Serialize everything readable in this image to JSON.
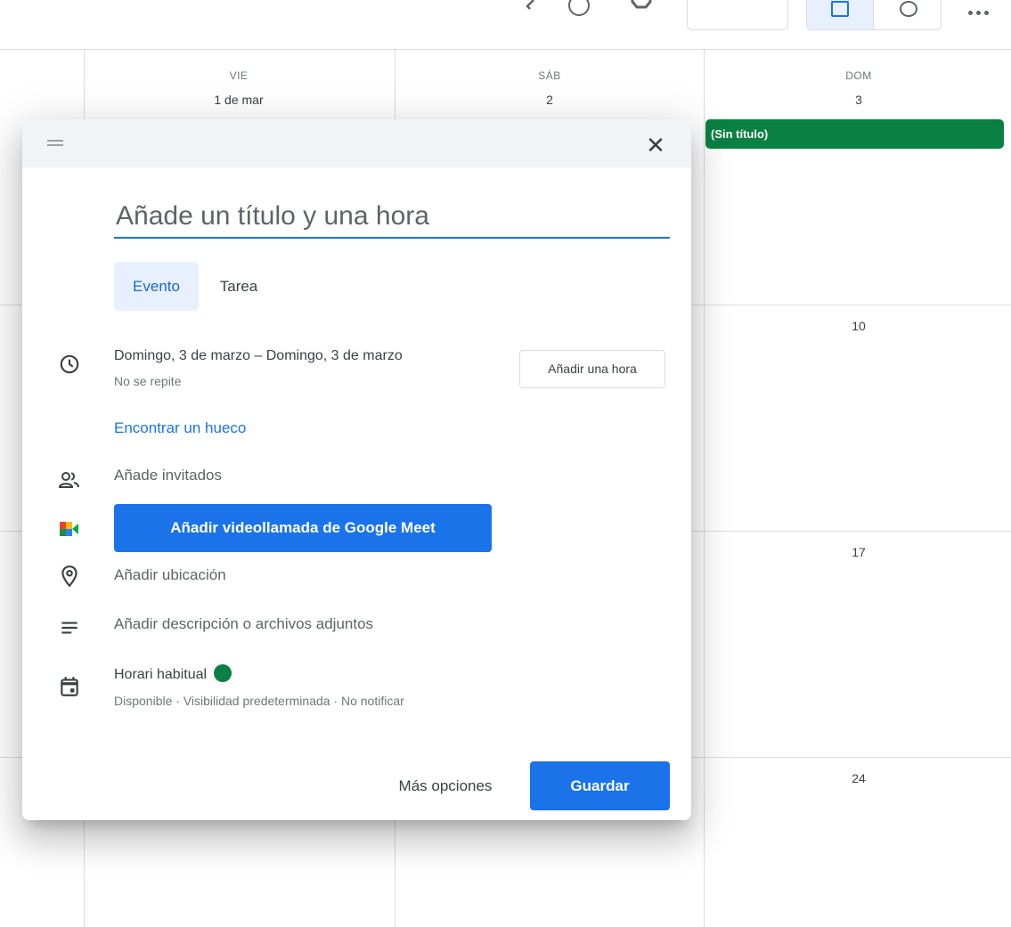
{
  "toolbar": {
    "icons": [
      "back-icon",
      "help-icon",
      "settings-icon",
      "calendar-view-icon",
      "tasks-icon",
      "more-icon"
    ]
  },
  "calendar": {
    "days": [
      {
        "name": "VIE",
        "date": "1 de mar"
      },
      {
        "name": "SÁB",
        "date": "2"
      },
      {
        "name": "DOM",
        "date": "3"
      }
    ],
    "week_dates": [
      "10",
      "17",
      "24"
    ],
    "event": {
      "title": "(Sin título)",
      "color": "#0b8043"
    }
  },
  "dialog": {
    "title_placeholder": "Añade un título y una hora",
    "tabs": [
      {
        "label": "Evento",
        "active": true
      },
      {
        "label": "Tarea",
        "active": false
      }
    ],
    "date_range": "Domingo, 3 de marzo  –  Domingo, 3 de marzo",
    "recurrence": "No se repite",
    "add_hour_label": "Añadir una hora",
    "find_slot_label": "Encontrar un hueco",
    "guests_placeholder": "Añade invitados",
    "meet_button_label": "Añadir videollamada de Google Meet",
    "location_placeholder": "Añadir ubicación",
    "description_placeholder": "Añadir descripción o archivos adjuntos",
    "calendar_name": "Horari habitual",
    "calendar_color": "#0b8043",
    "calendar_details": "Disponible · Visibilidad predeterminada · No notificar",
    "more_options_label": "Más opciones",
    "save_label": "Guardar"
  },
  "colors": {
    "accent": "#1a73e8",
    "event_green": "#0b8043"
  }
}
